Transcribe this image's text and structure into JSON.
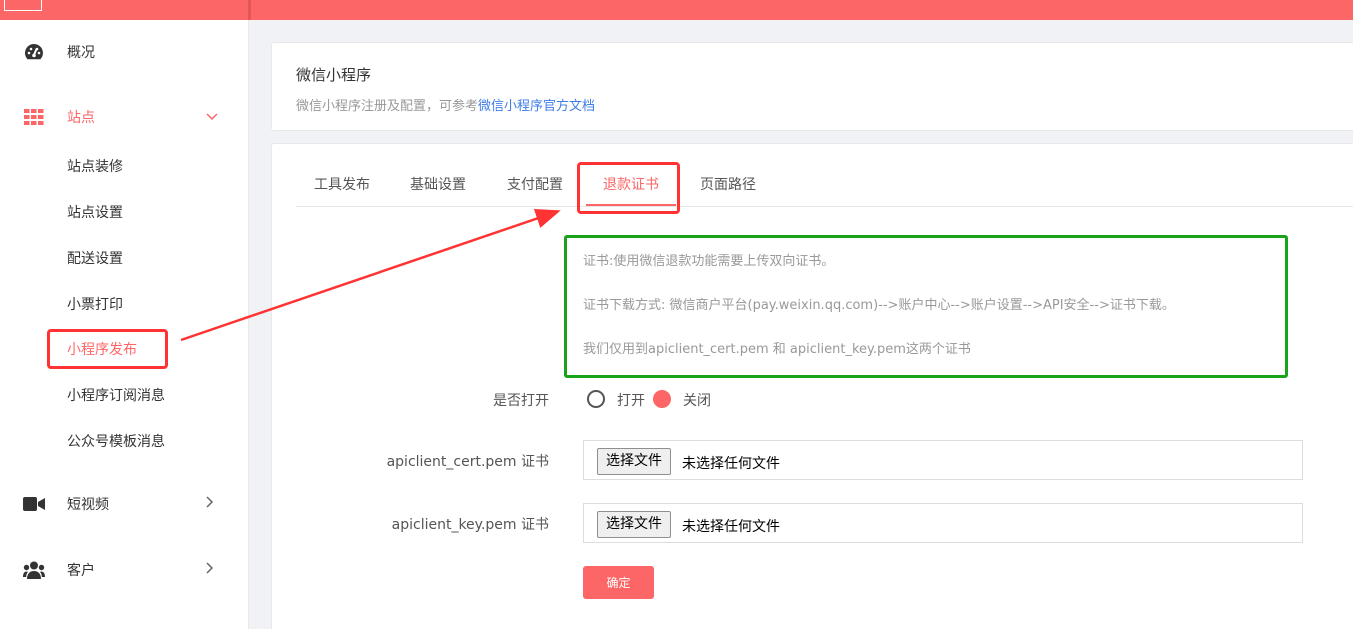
{
  "sidebar": {
    "overview_label": "概况",
    "site_label": "站点",
    "site_children": [
      "站点装修",
      "站点设置",
      "配送设置",
      "小票打印",
      "小程序发布",
      "小程序订阅消息",
      "公众号模板消息"
    ],
    "video_label": "短视频",
    "customer_label": "客户"
  },
  "header_card": {
    "title": "微信小程序",
    "desc_prefix": "微信小程序注册及配置，可参考",
    "desc_link": "微信小程序官方文档"
  },
  "tabs": [
    "工具发布",
    "基础设置",
    "支付配置",
    "退款证书",
    "页面路径"
  ],
  "active_tab_index": 3,
  "notice": {
    "line1": "证书:使用微信退款功能需要上传双向证书。",
    "line2": "证书下载方式: 微信商户平台(pay.weixin.qq.com)-->账户中心-->账户设置-->API安全-->证书下载。",
    "line3": "我们仅用到apiclient_cert.pem 和 apiclient_key.pem这两个证书"
  },
  "form": {
    "toggle_label": "是否打开",
    "toggle_on": "打开",
    "toggle_off": "关闭",
    "toggle_value": "关闭",
    "cert_label": "apiclient_cert.pem 证书",
    "key_label": "apiclient_key.pem 证书",
    "file_button": "选择文件",
    "file_status": "未选择任何文件",
    "submit": "确定"
  },
  "colors": {
    "accent": "#fd6666",
    "annotation_red": "#ff3333",
    "annotation_green": "#1aa31a",
    "link": "#3f7de8"
  }
}
